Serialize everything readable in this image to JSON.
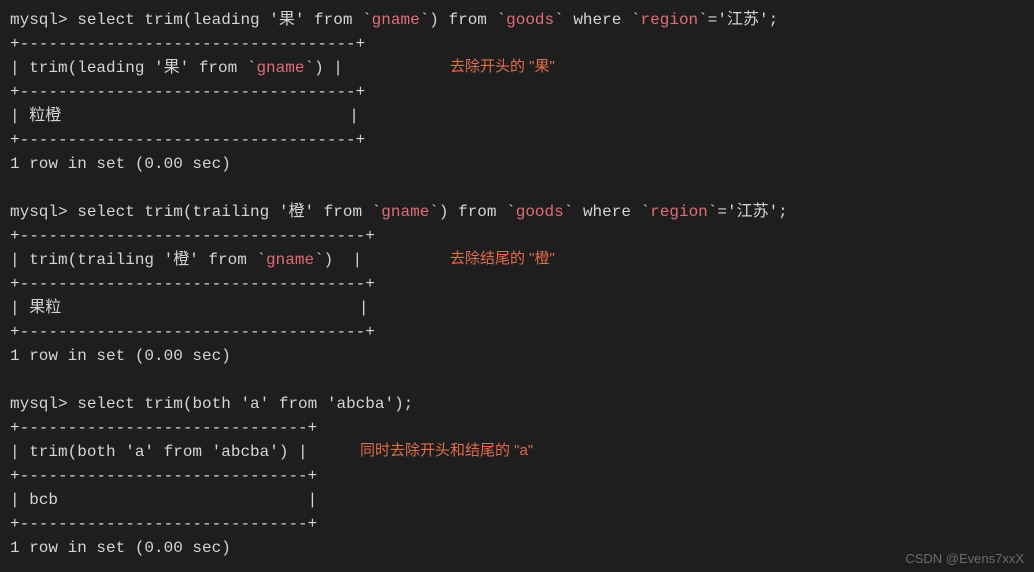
{
  "q1": {
    "prompt": "mysql> ",
    "p1": "select trim(leading '果' from `",
    "gname": "gname",
    "p2": "`) from `",
    "goods": "goods",
    "p3": "` where `",
    "region": "region",
    "p4": "`='江苏';",
    "sep": "+-----------------------------------+",
    "hdr_a": "| trim(leading '果' from `",
    "hdr_b": "`) |",
    "row": "| 粒橙                              |",
    "foot": "1 row in set (0.00 sec)",
    "anno": "去除开头的 \"果\""
  },
  "q2": {
    "prompt": "mysql> ",
    "p1": "select trim(trailing '橙' from `",
    "gname": "gname",
    "p2": "`) from `",
    "goods": "goods",
    "p3": "` where `",
    "region": "region",
    "p4": "`='江苏';",
    "sep": "+------------------------------------+",
    "hdr_a": "| trim(trailing '橙' from `",
    "hdr_b": "`)  |",
    "row": "| 果粒                               |",
    "foot": "1 row in set (0.00 sec)",
    "anno": "去除结尾的 \"橙\""
  },
  "q3": {
    "prompt": "mysql> ",
    "p1": "select trim(both 'a' from 'abcba');",
    "sep": "+------------------------------+",
    "hdr": "| trim(both 'a' from 'abcba') |",
    "row": "| bcb                          |",
    "foot": "1 row in set (0.00 sec)",
    "anno": "同时去除开头和结尾的 \"a\""
  },
  "watermark": "CSDN @Evens7xxX"
}
